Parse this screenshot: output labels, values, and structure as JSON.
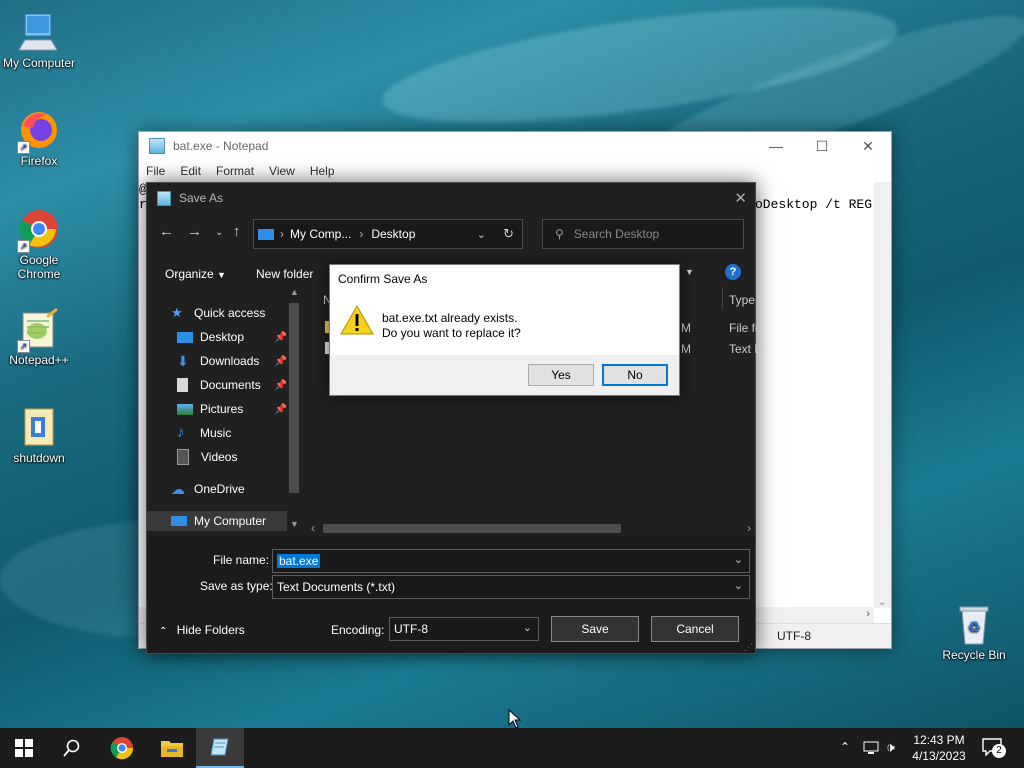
{
  "desktop": {
    "icons": [
      {
        "label": "My Computer",
        "icon": "computer-icon"
      },
      {
        "label": "Firefox",
        "icon": "firefox-icon"
      },
      {
        "label": "Google Chrome",
        "icon": "chrome-icon"
      },
      {
        "label": "Notepad++",
        "icon": "notepadpp-icon"
      },
      {
        "label": "shutdown",
        "icon": "batch-file-icon"
      },
      {
        "label": "Recycle Bin",
        "icon": "recycle-bin-icon"
      }
    ]
  },
  "notepad": {
    "title": "bat.exe - Notepad",
    "menu": [
      "File",
      "Edit",
      "Format",
      "View",
      "Help"
    ],
    "text_line1_prefix": "@",
    "text_line2_prefix": "r",
    "text_visible_fragment": "oDesktop /t REG",
    "encoding_status": "UTF-8"
  },
  "save_as": {
    "title": "Save As",
    "address": {
      "root": "My Comp...",
      "current": "Desktop"
    },
    "search_placeholder": "Search Desktop",
    "toolbar": {
      "organize": "Organize",
      "new_folder": "New folder"
    },
    "sidebar": [
      {
        "label": "Quick access",
        "icon": "star-icon",
        "pinned": false
      },
      {
        "label": "Desktop",
        "icon": "desktop-folder-icon",
        "pinned": true
      },
      {
        "label": "Downloads",
        "icon": "download-icon",
        "pinned": true
      },
      {
        "label": "Documents",
        "icon": "documents-icon",
        "pinned": true
      },
      {
        "label": "Pictures",
        "icon": "pictures-icon",
        "pinned": true
      },
      {
        "label": "Music",
        "icon": "music-icon",
        "pinned": false
      },
      {
        "label": "Videos",
        "icon": "videos-icon",
        "pinned": false
      },
      {
        "label": "OneDrive",
        "icon": "cloud-icon",
        "pinned": false
      },
      {
        "label": "My Computer",
        "icon": "computer-icon",
        "pinned": false
      }
    ],
    "file_list": {
      "column_header_partial": "N",
      "type_header": "Type",
      "rows": [
        {
          "time_fragment": "M",
          "type_fragment": "File fo"
        },
        {
          "time_fragment": "M",
          "type_fragment": "Text D"
        }
      ]
    },
    "file_name_label": "File name:",
    "file_name_value": "bat.exe",
    "save_as_type_label": "Save as type:",
    "save_as_type_value": "Text Documents (*.txt)",
    "hide_folders": "Hide Folders",
    "encoding_label": "Encoding:",
    "encoding_value": "UTF-8",
    "save_button": "Save",
    "cancel_button": "Cancel"
  },
  "confirm": {
    "title": "Confirm Save As",
    "message_line1": "bat.exe.txt already exists.",
    "message_line2": "Do you want to replace it?",
    "yes": "Yes",
    "no": "No"
  },
  "taskbar": {
    "time": "12:43 PM",
    "date": "4/13/2023",
    "notification_count": "2"
  }
}
